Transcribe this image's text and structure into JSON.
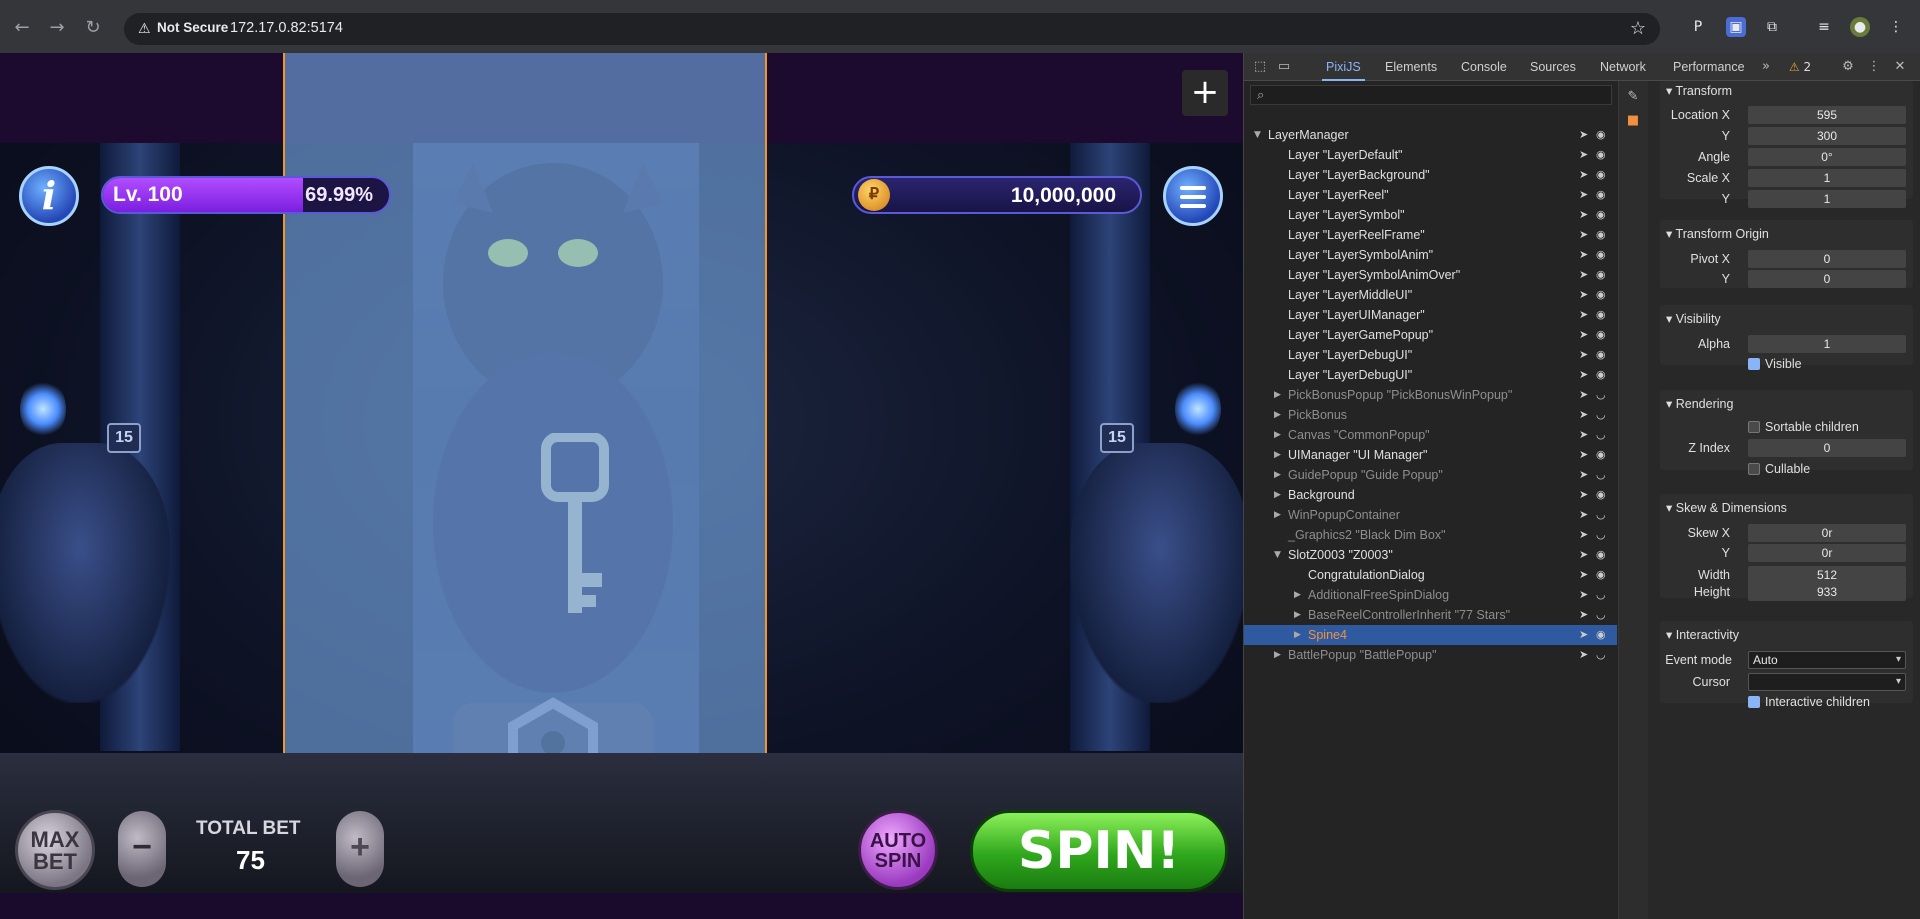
{
  "browser": {
    "security_label": "Not Secure",
    "url": "172.17.0.82:5174"
  },
  "game": {
    "level_label": "Lv. 100",
    "level_progress_text": "69.99%",
    "level_progress": 0.6999,
    "coins": "10,000,000",
    "total_bet_label": "TOTAL BET",
    "total_bet_value": "75",
    "max_bet_line1": "MAX",
    "max_bet_line2": "BET",
    "auto_spin_line1": "AUTO",
    "auto_spin_line2": "SPIN",
    "spin_label": "SPIN!",
    "pillar_number": "15"
  },
  "devtools": {
    "tabs": [
      "PixiJS",
      "Elements",
      "Console",
      "Sources",
      "Network",
      "Performance"
    ],
    "issues_count": "2",
    "tree": [
      {
        "label": "LayerManager",
        "indent": 0,
        "toggle": "open",
        "dim": false,
        "eye": true
      },
      {
        "label": "Layer \"LayerDefault\"",
        "indent": 1,
        "toggle": "none",
        "dim": false,
        "eye": true
      },
      {
        "label": "Layer \"LayerBackground\"",
        "indent": 1,
        "toggle": "none",
        "dim": false,
        "eye": true
      },
      {
        "label": "Layer \"LayerReel\"",
        "indent": 1,
        "toggle": "none",
        "dim": false,
        "eye": true
      },
      {
        "label": "Layer \"LayerSymbol\"",
        "indent": 1,
        "toggle": "none",
        "dim": false,
        "eye": true
      },
      {
        "label": "Layer \"LayerReelFrame\"",
        "indent": 1,
        "toggle": "none",
        "dim": false,
        "eye": true
      },
      {
        "label": "Layer \"LayerSymbolAnim\"",
        "indent": 1,
        "toggle": "none",
        "dim": false,
        "eye": true
      },
      {
        "label": "Layer \"LayerSymbolAnimOver\"",
        "indent": 1,
        "toggle": "none",
        "dim": false,
        "eye": true
      },
      {
        "label": "Layer \"LayerMiddleUI\"",
        "indent": 1,
        "toggle": "none",
        "dim": false,
        "eye": true
      },
      {
        "label": "Layer \"LayerUIManager\"",
        "indent": 1,
        "toggle": "none",
        "dim": false,
        "eye": true
      },
      {
        "label": "Layer \"LayerGamePopup\"",
        "indent": 1,
        "toggle": "none",
        "dim": false,
        "eye": true
      },
      {
        "label": "Layer \"LayerDebugUI\"",
        "indent": 1,
        "toggle": "none",
        "dim": false,
        "eye": true
      },
      {
        "label": "Layer \"LayerDebugUI\"",
        "indent": 1,
        "toggle": "none",
        "dim": false,
        "eye": true
      },
      {
        "label": "PickBonusPopup \"PickBonusWinPopup\"",
        "indent": 1,
        "toggle": "closed",
        "dim": true,
        "eye": false
      },
      {
        "label": "PickBonus",
        "indent": 1,
        "toggle": "closed",
        "dim": true,
        "eye": false
      },
      {
        "label": "Canvas \"CommonPopup\"",
        "indent": 1,
        "toggle": "closed",
        "dim": true,
        "eye": false
      },
      {
        "label": "UIManager \"UI Manager\"",
        "indent": 1,
        "toggle": "closed",
        "dim": false,
        "eye": true
      },
      {
        "label": "GuidePopup \"Guide Popup\"",
        "indent": 1,
        "toggle": "closed",
        "dim": true,
        "eye": false
      },
      {
        "label": "Background",
        "indent": 1,
        "toggle": "closed",
        "dim": false,
        "eye": true
      },
      {
        "label": "WinPopupContainer",
        "indent": 1,
        "toggle": "closed",
        "dim": true,
        "eye": false
      },
      {
        "label": "_Graphics2 \"Black Dim Box\"",
        "indent": 1,
        "toggle": "none",
        "dim": true,
        "eye": false
      },
      {
        "label": "SlotZ0003 \"Z0003\"",
        "indent": 1,
        "toggle": "open",
        "dim": false,
        "eye": true
      },
      {
        "label": "CongratulationDialog",
        "indent": 2,
        "toggle": "none",
        "dim": false,
        "eye": true
      },
      {
        "label": "AdditionalFreeSpinDialog",
        "indent": 2,
        "toggle": "closed",
        "dim": true,
        "eye": false
      },
      {
        "label": "BaseReelControllerInherit \"77 Stars\"",
        "indent": 2,
        "toggle": "closed",
        "dim": true,
        "eye": false
      },
      {
        "label": "Spine4",
        "indent": 2,
        "toggle": "closed",
        "dim": false,
        "eye": true,
        "selected": true
      },
      {
        "label": "BattlePopup \"BattlePopup\"",
        "indent": 1,
        "toggle": "closed",
        "dim": true,
        "eye": false
      }
    ],
    "props": {
      "transform_title": "Transform",
      "location_x_label": "Location X",
      "location_x": "595",
      "location_y_label": "Y",
      "location_y": "300",
      "angle_label": "Angle",
      "angle": "0°",
      "scale_x_label": "Scale X",
      "scale_x": "1",
      "scale_y_label": "Y",
      "scale_y": "1",
      "origin_title": "Transform Origin",
      "pivot_x_label": "Pivot X",
      "pivot_x": "0",
      "pivot_y_label": "Y",
      "pivot_y": "0",
      "visibility_title": "Visibility",
      "alpha_label": "Alpha",
      "alpha": "1",
      "visible_label": "Visible",
      "rendering_title": "Rendering",
      "sortable_label": "Sortable children",
      "zindex_label": "Z Index",
      "zindex": "0",
      "cullable_label": "Cullable",
      "skew_title": "Skew & Dimensions",
      "skew_x_label": "Skew X",
      "skew_x": "0r",
      "skew_y_label": "Y",
      "skew_y": "0r",
      "width_label": "Width",
      "width": "512",
      "height_label": "Height",
      "height": "933",
      "interactivity_title": "Interactivity",
      "event_mode_label": "Event mode",
      "event_mode": "Auto",
      "cursor_label": "Cursor",
      "cursor": "",
      "interactive_children_label": "Interactive children"
    }
  }
}
